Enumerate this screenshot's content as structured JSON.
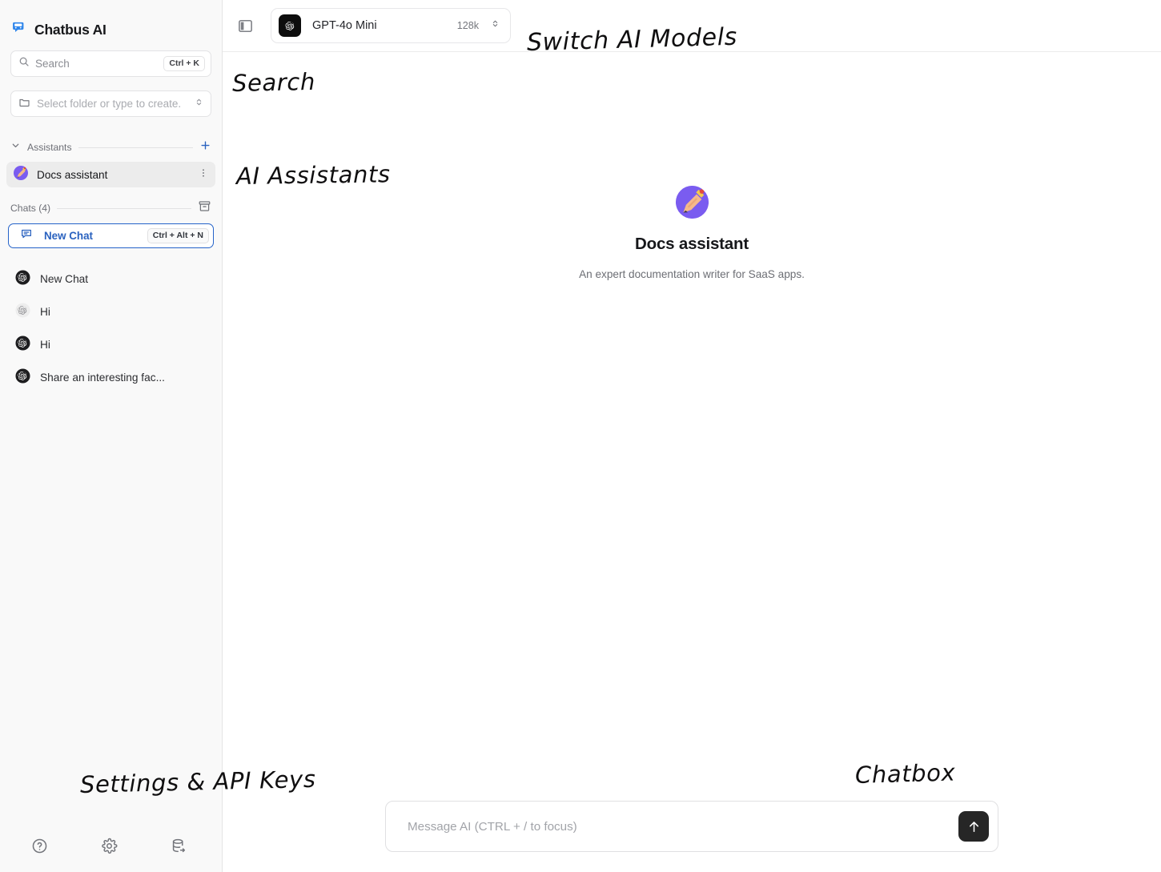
{
  "app": {
    "brand": "Chatbus AI",
    "brand_icon": "bus-icon",
    "accent_blue": "#2563c9",
    "sidebar_bg": "#f9f9f9",
    "avatar_purple": "#7a5cf0",
    "send_button_bg": "#262626"
  },
  "sidebar": {
    "search": {
      "placeholder": "Search",
      "icon": "search-icon",
      "shortcut": "Ctrl + K"
    },
    "folder_select": {
      "placeholder": "Select folder or type to create.",
      "icon": "folder-icon",
      "chevron": "chevron-up-down-icon"
    },
    "assistants_section": {
      "label": "Assistants",
      "collapse_icon": "chevron-down-icon",
      "add_icon": "plus-icon",
      "items": [
        {
          "name": "Docs assistant",
          "avatar": "writing-hand-avatar",
          "menu_icon": "more-vertical-icon",
          "selected": true
        }
      ]
    },
    "chats_section": {
      "label": "Chats (4)",
      "archive_icon": "archive-box-icon",
      "new_chat": {
        "label": "New Chat",
        "icon": "message-square-icon",
        "shortcut": "Ctrl + Alt + N"
      },
      "items": [
        {
          "title": "New Chat",
          "icon": "openai-logo-icon"
        },
        {
          "title": "Hi",
          "icon": "openai-logo-icon"
        },
        {
          "title": "Hi",
          "icon": "openai-logo-icon"
        },
        {
          "title": "Share an interesting fac...",
          "icon": "openai-logo-icon"
        }
      ]
    },
    "footer_icons": [
      {
        "name": "help-circle-icon",
        "title": "Help"
      },
      {
        "name": "gear-icon",
        "title": "Settings"
      },
      {
        "name": "database-export-icon",
        "title": "Data"
      }
    ]
  },
  "topbar": {
    "panel_toggle_icon": "sidebar-toggle-icon",
    "model_selector": {
      "icon": "openai-logo-icon",
      "name": "GPT-4o Mini",
      "context": "128k",
      "chevron": "chevron-up-down-icon"
    }
  },
  "main": {
    "empty_state": {
      "avatar": "writing-hand-avatar",
      "title": "Docs assistant",
      "subtitle": "An expert documentation writer for SaaS apps."
    },
    "composer": {
      "placeholder": "Message AI (CTRL + / to focus)",
      "send_icon": "arrow-up-icon"
    }
  },
  "annotations": [
    {
      "id": "anno-models",
      "text": "Switch AI Models"
    },
    {
      "id": "anno-search",
      "text": "Search"
    },
    {
      "id": "anno-assist",
      "text": "AI Assistants"
    },
    {
      "id": "anno-settings",
      "text": "Settings & API Keys"
    },
    {
      "id": "anno-chatbox",
      "text": "Chatbox"
    }
  ]
}
